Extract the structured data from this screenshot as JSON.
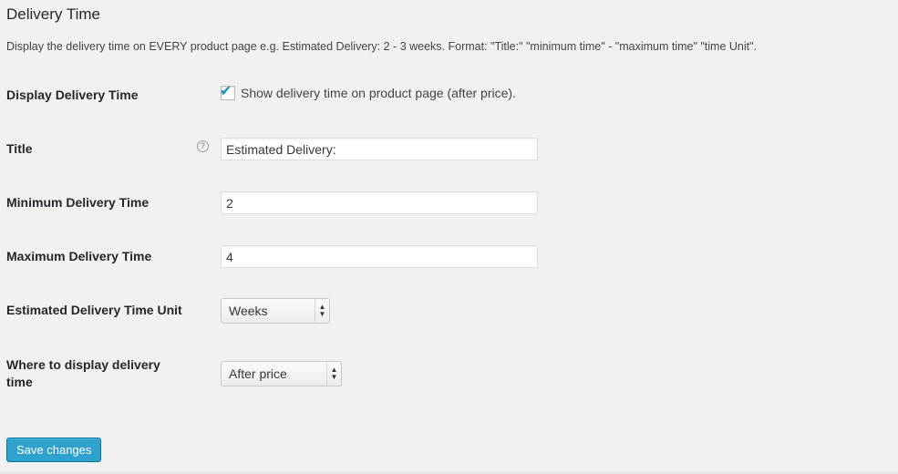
{
  "section": {
    "title": "Delivery Time",
    "description": "Display the delivery time on EVERY product page e.g. Estimated Delivery: 2 - 3 weeks. Format: \"Title:\" \"minimum time\" - \"maximum time\" \"time Unit\"."
  },
  "fields": {
    "display": {
      "label": "Display Delivery Time",
      "checkbox_label": "Show delivery time on product page (after price).",
      "checked": true
    },
    "title": {
      "label": "Title",
      "help_icon": "question-mark-circle",
      "value": "Estimated Delivery:"
    },
    "min_time": {
      "label": "Minimum Delivery Time",
      "value": "2"
    },
    "max_time": {
      "label": "Maximum Delivery Time",
      "value": "4"
    },
    "unit": {
      "label": "Estimated Delivery Time Unit",
      "selected": "Weeks"
    },
    "position": {
      "label_line1": "Where to display delivery",
      "label_line2": "time",
      "selected": "After price"
    }
  },
  "actions": {
    "save_label": "Save changes"
  },
  "colors": {
    "background": "#f1f1f1",
    "accent": "#2ea2cc",
    "checkmark": "#1e8cbe"
  }
}
